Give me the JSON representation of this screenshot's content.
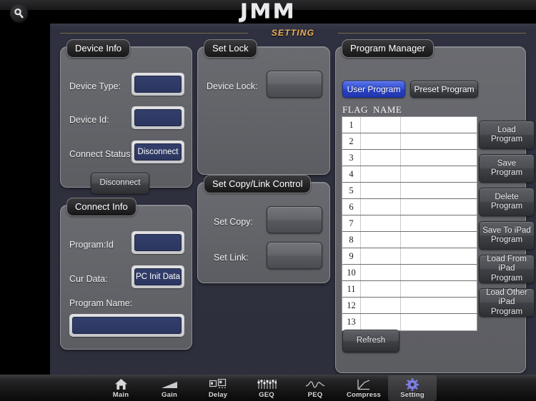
{
  "topbar": {
    "logo_text": "JMM",
    "search_icon": "search-icon"
  },
  "stage": {
    "title": "SETTING"
  },
  "device_info": {
    "title": "Device Info",
    "rows": [
      {
        "label": "Device Type:",
        "value": ""
      },
      {
        "label": "Device Id:",
        "value": ""
      },
      {
        "label": "Connect Status:",
        "value": "Disconnect"
      }
    ],
    "action_button": "Disconnect"
  },
  "connect_info": {
    "title": "Connect Info",
    "rows": [
      {
        "label": "Program:Id",
        "value": ""
      },
      {
        "label": "Cur Data:",
        "value": "PC Init Data"
      }
    ],
    "program_name_label": "Program Name:",
    "program_name_value": ""
  },
  "set_lock": {
    "title": "Set Lock",
    "device_lock_label": "Device Lock:",
    "device_lock_value": ""
  },
  "set_copy_link": {
    "title": "Set Copy/Link Control",
    "set_copy_label": "Set Copy:",
    "set_copy_value": "",
    "set_link_label": "Set Link:",
    "set_link_value": ""
  },
  "program_manager": {
    "title": "Program Manager",
    "tabs": [
      {
        "label": "User Program",
        "active": true
      },
      {
        "label": "Preset Program",
        "active": false
      }
    ],
    "columns": [
      "FLAG",
      "NAME"
    ],
    "rows": [
      {
        "index": "1",
        "flag": "",
        "name": ""
      },
      {
        "index": "2",
        "flag": "",
        "name": ""
      },
      {
        "index": "3",
        "flag": "",
        "name": ""
      },
      {
        "index": "4",
        "flag": "",
        "name": ""
      },
      {
        "index": "5",
        "flag": "",
        "name": ""
      },
      {
        "index": "6",
        "flag": "",
        "name": ""
      },
      {
        "index": "7",
        "flag": "",
        "name": ""
      },
      {
        "index": "8",
        "flag": "",
        "name": ""
      },
      {
        "index": "9",
        "flag": "",
        "name": ""
      },
      {
        "index": "10",
        "flag": "",
        "name": ""
      },
      {
        "index": "11",
        "flag": "",
        "name": ""
      },
      {
        "index": "12",
        "flag": "",
        "name": ""
      },
      {
        "index": "13",
        "flag": "",
        "name": ""
      }
    ],
    "side_buttons": [
      "Load\nProgram",
      "Save\nProgram",
      "Delete\nProgram",
      "Save To iPad\nProgram",
      "Load From iPad\nProgram",
      "Load Other iPad\nProgram"
    ],
    "refresh_button": "Refresh"
  },
  "navbar": {
    "items": [
      {
        "label": "Main",
        "icon": "home-icon",
        "active": false
      },
      {
        "label": "Gain",
        "icon": "gain-ramp-icon",
        "active": false
      },
      {
        "label": "Delay",
        "icon": "delay-icon",
        "active": false
      },
      {
        "label": "GEQ",
        "icon": "sliders-icon",
        "active": false
      },
      {
        "label": "PEQ",
        "icon": "eq-curve-icon",
        "active": false
      },
      {
        "label": "Compress",
        "icon": "compress-icon",
        "active": false
      },
      {
        "label": "Setting",
        "icon": "gear-icon",
        "active": true
      }
    ]
  },
  "colors": {
    "accent_title": "#f0b05a",
    "active_tab_blue": "#3552d8",
    "field_blue": "#333f6b",
    "panel_gray": "#636469",
    "stage_bg": "#2e3040"
  }
}
